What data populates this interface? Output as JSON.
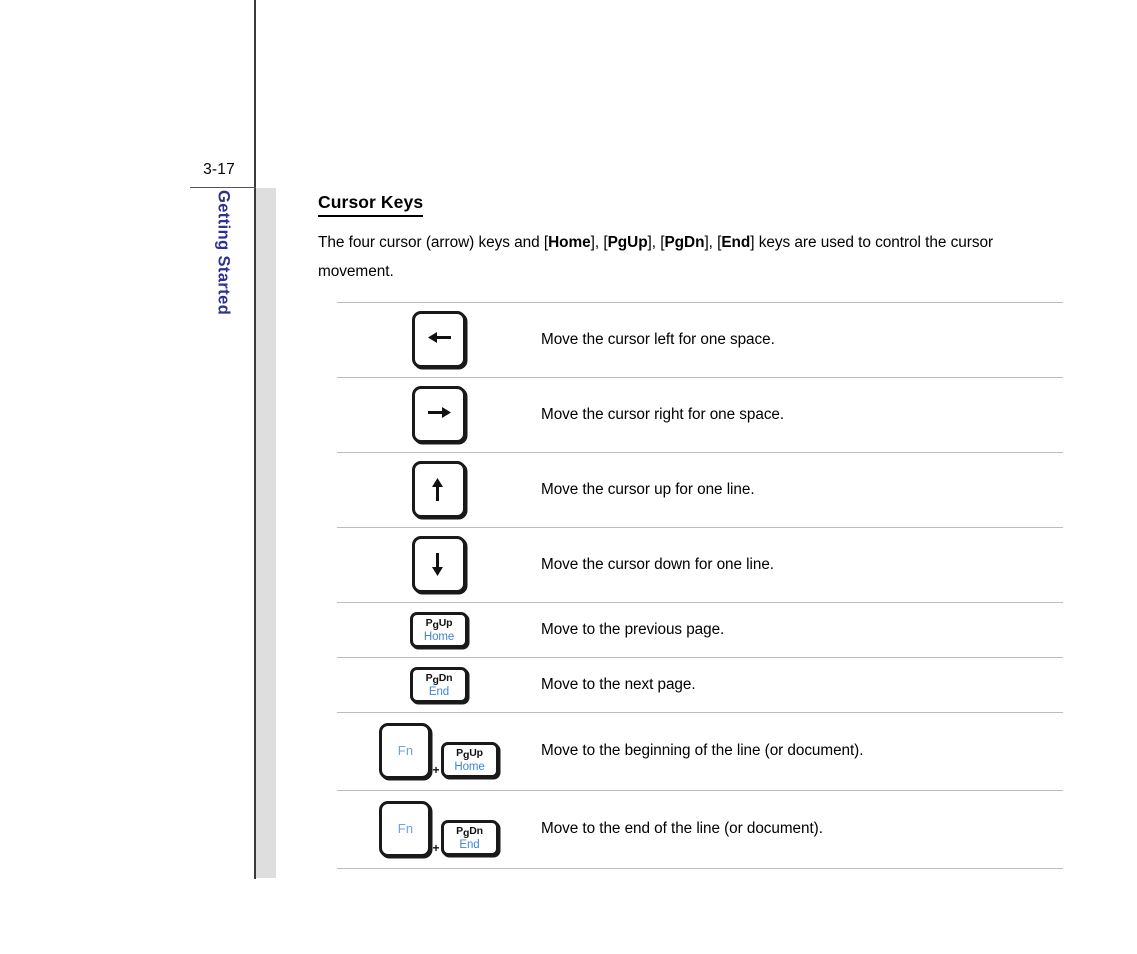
{
  "page": {
    "number": "3-17",
    "side_tab_label": "Getting Started",
    "side_tab_color": "#2f3192",
    "accent_blue": "#3c86d8",
    "fn_blue": "#6aa3dd",
    "rule_gray": "#bdbdbd",
    "tab_bar_gray": "#dedede"
  },
  "section": {
    "title": "Cursor Keys",
    "intro_part1": "The four cursor (arrow) keys and [",
    "intro_home": "Home",
    "intro_part2": "], [",
    "intro_pgup": "PgUp",
    "intro_part3": "], [",
    "intro_pgdn": "PgDn",
    "intro_part4": "], [",
    "intro_end": "End",
    "intro_part5": "] keys are used to control the cursor movement."
  },
  "key_table": {
    "rows": [
      {
        "key_type": "arrow",
        "key_name": "arrow-left-key",
        "arrow_direction": "left",
        "description": "Move the cursor left for one space."
      },
      {
        "key_type": "arrow",
        "key_name": "arrow-right-key",
        "arrow_direction": "right",
        "description": "Move the cursor right for one space."
      },
      {
        "key_type": "arrow",
        "key_name": "arrow-up-key",
        "arrow_direction": "up",
        "description": "Move the cursor up for one line."
      },
      {
        "key_type": "arrow",
        "key_name": "arrow-down-key",
        "arrow_direction": "down",
        "description": "Move the cursor down for one line."
      },
      {
        "key_type": "dual",
        "key_name": "pgup-home-key",
        "top_pre": "P",
        "top_sub": "g",
        "top_post": "Up",
        "bottom": "Home",
        "description": "Move to the previous page."
      },
      {
        "key_type": "dual",
        "key_name": "pgdn-end-key",
        "top_pre": "P",
        "top_sub": "g",
        "top_post": "Dn",
        "bottom": "End",
        "description": "Move to the next page."
      },
      {
        "key_type": "combo",
        "key_name": "fn-plus-pgup-home-key",
        "fn_label": "Fn",
        "plus": "+",
        "top_pre": "P",
        "top_sub": "g",
        "top_post": "Up",
        "bottom": "Home",
        "description": "Move to the beginning of the line (or document)."
      },
      {
        "key_type": "combo",
        "key_name": "fn-plus-pgdn-end-key",
        "fn_label": "Fn",
        "plus": "+",
        "top_pre": "P",
        "top_sub": "g",
        "top_post": "Dn",
        "bottom": "End",
        "description": "Move to the end of the line (or document)."
      }
    ]
  }
}
